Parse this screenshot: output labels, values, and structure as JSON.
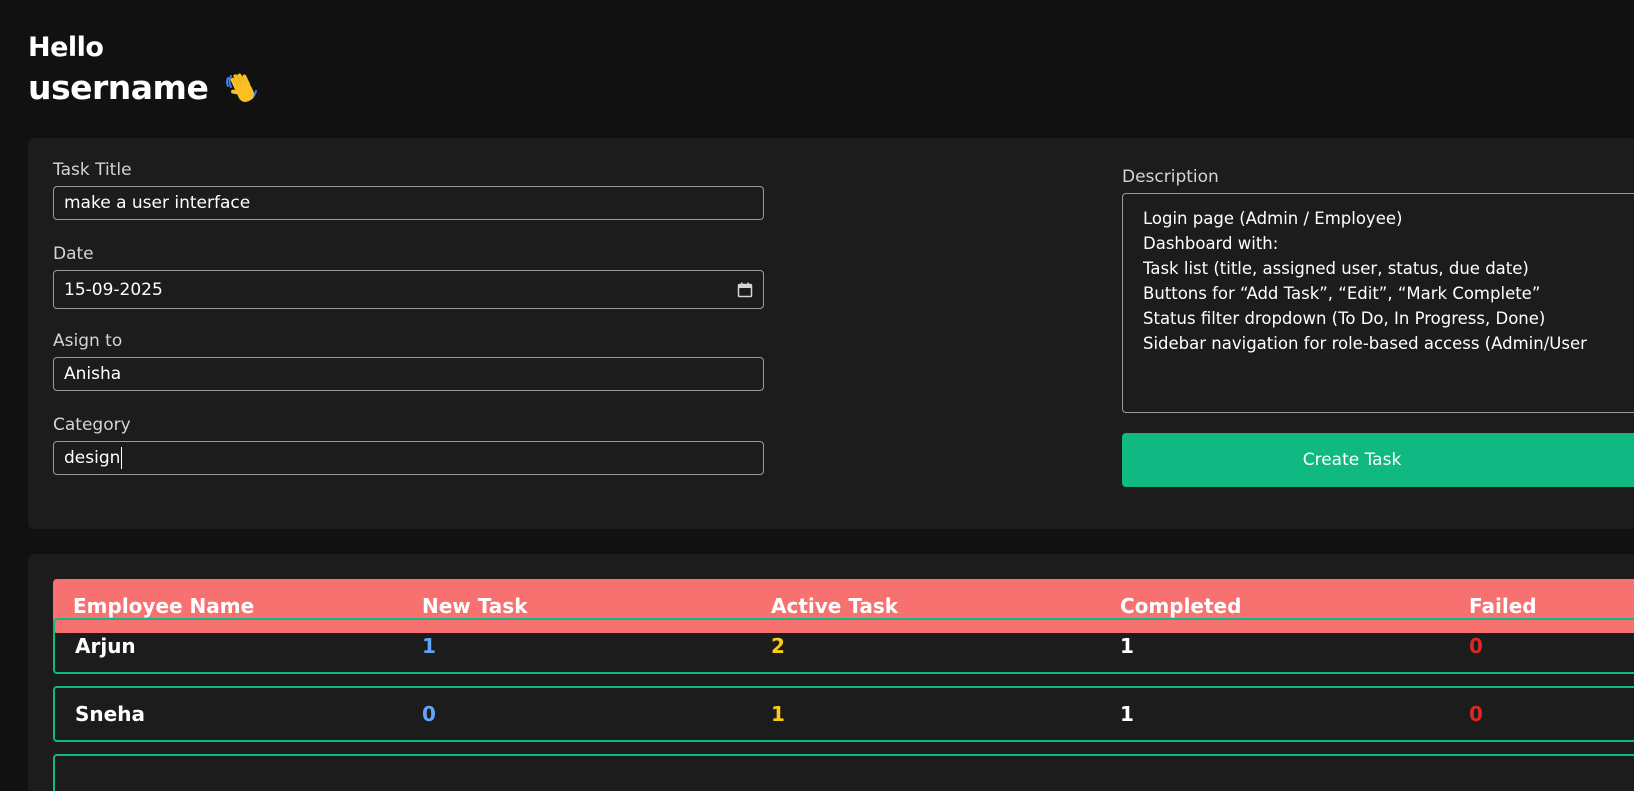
{
  "greeting": {
    "hello": "Hello",
    "username": "username",
    "emoji": "👋"
  },
  "form": {
    "task_title": {
      "label": "Task Title",
      "value": "make a user interface"
    },
    "date": {
      "label": "Date",
      "value": "15-09-2025"
    },
    "assign_to": {
      "label": "Asign to",
      "value": "Anisha"
    },
    "category": {
      "label": "Category",
      "value": "design"
    },
    "description": {
      "label": "Description",
      "lines": [
        "Login page (Admin / Employee)",
        "Dashboard with:",
        "Task list (title, assigned user, status, due date)",
        "Buttons for “Add Task”, “Edit”, “Mark Complete”",
        "Status filter dropdown (To Do, In Progress, Done)",
        "Sidebar navigation for role-based access (Admin/User"
      ]
    },
    "create_button": "Create Task"
  },
  "table": {
    "headers": [
      "Employee Name",
      "New Task",
      "Active Task",
      "Completed",
      "Failed"
    ],
    "rows": [
      {
        "name": "Arjun",
        "new": "1",
        "active": "2",
        "completed": "1",
        "failed": "0"
      },
      {
        "name": "Sneha",
        "new": "0",
        "active": "1",
        "completed": "1",
        "failed": "0"
      }
    ]
  },
  "colors": {
    "background": "#111111",
    "panel": "#1c1c1c",
    "accent_green": "#10b981",
    "header_red": "#f87171",
    "new_blue": "#60a5fa",
    "active_yellow": "#facc15",
    "failed_red": "#dc2626"
  }
}
